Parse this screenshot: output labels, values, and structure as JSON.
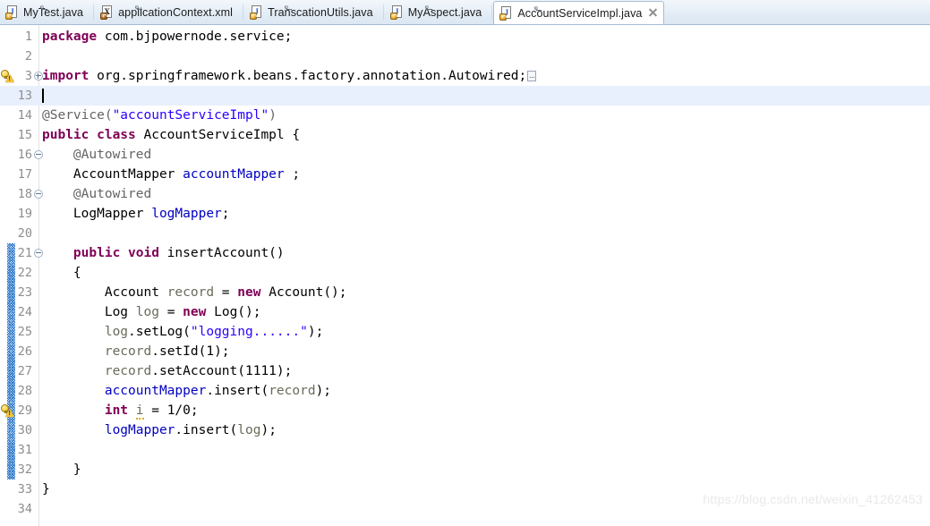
{
  "window": {
    "application": "Eclipse IDE",
    "active_file": "AccountServiceImpl.java"
  },
  "tabs": [
    {
      "label": "MyTest.java",
      "icon": "java-file-icon",
      "glyph": "J",
      "active": false
    },
    {
      "label": "applicationContext.xml",
      "icon": "xml-file-icon",
      "glyph": "X",
      "active": false
    },
    {
      "label": "TranscationUtils.java",
      "icon": "java-file-icon",
      "glyph": "J",
      "active": false
    },
    {
      "label": "MyAspect.java",
      "icon": "java-file-icon",
      "glyph": "J",
      "active": false
    },
    {
      "label": "AccountServiceImpl.java",
      "icon": "java-file-icon",
      "glyph": "J",
      "active": true,
      "close_icon": "close-icon"
    }
  ],
  "editor": {
    "current_line": 13,
    "colors": {
      "keyword": "#7f0055",
      "string": "#2a00ff",
      "field": "#0000c0",
      "local_variable": "#6a6a5a",
      "annotation": "#646464",
      "plain": "#000000",
      "current_line_highlight": "#e8f0fd",
      "line_number": "#8d8d8d",
      "change_bar": "#2f78c8"
    },
    "change_bar_lines": [
      21,
      22,
      23,
      24,
      25,
      26,
      27,
      28,
      29,
      30,
      31,
      32
    ],
    "warning_lines": [
      3,
      29
    ],
    "lines": [
      {
        "n": 1,
        "fold": null,
        "tokens": [
          {
            "t": "package",
            "c": "kw"
          },
          {
            "t": " com.bjpowernode.service;",
            "c": "plain"
          }
        ]
      },
      {
        "n": 2,
        "fold": null,
        "tokens": []
      },
      {
        "n": 3,
        "fold": "plus",
        "warn": true,
        "tokens": [
          {
            "t": "import",
            "c": "kw"
          },
          {
            "t": " org.springframework.beans.factory.annotation.Autowired;",
            "c": "plain"
          },
          {
            "t": "",
            "c": "foldbox"
          }
        ]
      },
      {
        "n": 13,
        "fold": null,
        "current": true,
        "tokens": []
      },
      {
        "n": 14,
        "fold": null,
        "tokens": [
          {
            "t": "@Service(",
            "c": "ann"
          },
          {
            "t": "\"accountServiceImpl\"",
            "c": "str"
          },
          {
            "t": ")",
            "c": "ann"
          }
        ]
      },
      {
        "n": 15,
        "fold": null,
        "tokens": [
          {
            "t": "public class",
            "c": "kw"
          },
          {
            "t": " AccountServiceImpl {",
            "c": "plain"
          }
        ]
      },
      {
        "n": 16,
        "fold": "minus",
        "tokens": [
          {
            "t": "    @Autowired",
            "c": "ann"
          }
        ]
      },
      {
        "n": 17,
        "fold": null,
        "tokens": [
          {
            "t": "    AccountMapper ",
            "c": "plain"
          },
          {
            "t": "accountMapper",
            "c": "fld"
          },
          {
            "t": " ;",
            "c": "plain"
          }
        ]
      },
      {
        "n": 18,
        "fold": "minus",
        "tokens": [
          {
            "t": "    @Autowired",
            "c": "ann"
          }
        ]
      },
      {
        "n": 19,
        "fold": null,
        "tokens": [
          {
            "t": "    LogMapper ",
            "c": "plain"
          },
          {
            "t": "logMapper",
            "c": "fld"
          },
          {
            "t": ";",
            "c": "plain"
          }
        ]
      },
      {
        "n": 20,
        "fold": null,
        "tokens": []
      },
      {
        "n": 21,
        "fold": "minus",
        "tokens": [
          {
            "t": "    ",
            "c": "plain"
          },
          {
            "t": "public void",
            "c": "kw"
          },
          {
            "t": " insertAccount()",
            "c": "plain"
          }
        ]
      },
      {
        "n": 22,
        "fold": null,
        "tokens": [
          {
            "t": "    {",
            "c": "plain"
          }
        ]
      },
      {
        "n": 23,
        "fold": null,
        "tokens": [
          {
            "t": "        Account ",
            "c": "plain"
          },
          {
            "t": "record",
            "c": "lv"
          },
          {
            "t": " = ",
            "c": "plain"
          },
          {
            "t": "new",
            "c": "kw"
          },
          {
            "t": " Account();",
            "c": "plain"
          }
        ]
      },
      {
        "n": 24,
        "fold": null,
        "tokens": [
          {
            "t": "        Log ",
            "c": "plain"
          },
          {
            "t": "log",
            "c": "lv"
          },
          {
            "t": " = ",
            "c": "plain"
          },
          {
            "t": "new",
            "c": "kw"
          },
          {
            "t": " Log();",
            "c": "plain"
          }
        ]
      },
      {
        "n": 25,
        "fold": null,
        "tokens": [
          {
            "t": "        ",
            "c": "plain"
          },
          {
            "t": "log",
            "c": "lv"
          },
          {
            "t": ".setLog(",
            "c": "plain"
          },
          {
            "t": "\"logging......\"",
            "c": "str"
          },
          {
            "t": ");",
            "c": "plain"
          }
        ]
      },
      {
        "n": 26,
        "fold": null,
        "tokens": [
          {
            "t": "        ",
            "c": "plain"
          },
          {
            "t": "record",
            "c": "lv"
          },
          {
            "t": ".setId(1);",
            "c": "plain"
          }
        ]
      },
      {
        "n": 27,
        "fold": null,
        "tokens": [
          {
            "t": "        ",
            "c": "plain"
          },
          {
            "t": "record",
            "c": "lv"
          },
          {
            "t": ".setAccount(1111);",
            "c": "plain"
          }
        ]
      },
      {
        "n": 28,
        "fold": null,
        "tokens": [
          {
            "t": "        ",
            "c": "plain"
          },
          {
            "t": "accountMapper",
            "c": "fld"
          },
          {
            "t": ".insert(",
            "c": "plain"
          },
          {
            "t": "record",
            "c": "lv"
          },
          {
            "t": ");",
            "c": "plain"
          }
        ]
      },
      {
        "n": 29,
        "fold": null,
        "warn": true,
        "tokens": [
          {
            "t": "        ",
            "c": "plain"
          },
          {
            "t": "int",
            "c": "kw"
          },
          {
            "t": " ",
            "c": "plain"
          },
          {
            "t": "i",
            "c": "lv warnu"
          },
          {
            "t": " = 1/0;",
            "c": "plain"
          }
        ]
      },
      {
        "n": 30,
        "fold": null,
        "tokens": [
          {
            "t": "        ",
            "c": "plain"
          },
          {
            "t": "logMapper",
            "c": "fld"
          },
          {
            "t": ".insert(",
            "c": "plain"
          },
          {
            "t": "log",
            "c": "lv"
          },
          {
            "t": ");",
            "c": "plain"
          }
        ]
      },
      {
        "n": 31,
        "fold": null,
        "tokens": []
      },
      {
        "n": 32,
        "fold": null,
        "tokens": [
          {
            "t": "    }",
            "c": "plain"
          }
        ]
      },
      {
        "n": 33,
        "fold": null,
        "tokens": [
          {
            "t": "}",
            "c": "plain"
          }
        ]
      },
      {
        "n": 34,
        "fold": null,
        "tokens": []
      }
    ]
  },
  "watermark": {
    "text": "https://blog.csdn.net/weixin_41262453"
  }
}
